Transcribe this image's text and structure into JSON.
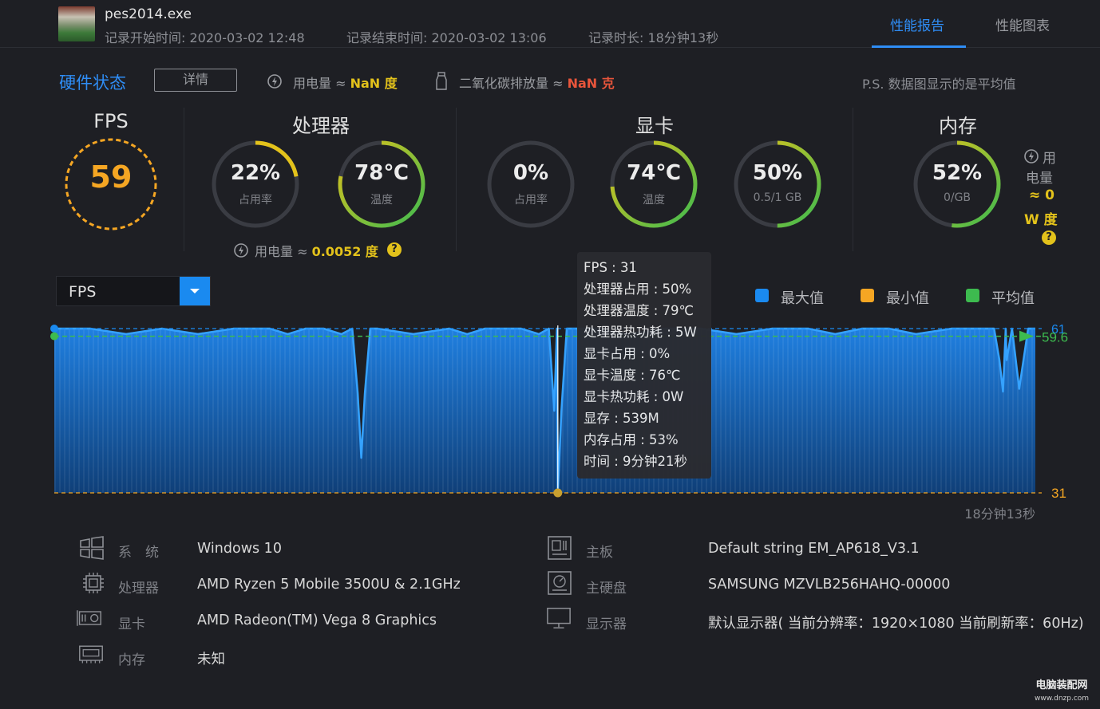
{
  "header": {
    "app_name": "pes2014.exe",
    "start_time": "记录开始时间: 2020-03-02 12:48",
    "end_time": "记录结束时间: 2020-03-02 13:06",
    "duration": "记录时长: 18分钟13秒",
    "tabs": [
      {
        "label": "性能报告",
        "active": true
      },
      {
        "label": "性能图表",
        "active": false
      }
    ]
  },
  "status": {
    "title": "硬件状态",
    "detail_button": "详情",
    "power_label": "用电量 ≈",
    "power_value": "NaN 度",
    "co2_label": "二氧化碳排放量 ≈",
    "co2_value": "NaN 克",
    "ps_note": "P.S. 数据图显示的是平均值"
  },
  "fps": {
    "title": "FPS",
    "value": "59"
  },
  "cpu": {
    "title": "处理器",
    "usage": {
      "value": "22%",
      "label": "占用率",
      "level": 0.22
    },
    "temp": {
      "value": "78℃",
      "label": "温度",
      "level": 0.78
    },
    "power_label": "用电量 ≈",
    "power_value": "0.0052 度",
    "help": "?"
  },
  "gpu": {
    "title": "显卡",
    "usage": {
      "value": "0%",
      "label": "占用率",
      "level": 0.0
    },
    "temp": {
      "value": "74℃",
      "label": "温度",
      "level": 0.74
    },
    "vram": {
      "value": "50%",
      "label": "0.5/1 GB",
      "level": 0.5
    }
  },
  "memory": {
    "title": "内存",
    "usage": {
      "value": "52%",
      "label": "0/GB",
      "level": 0.52
    },
    "power_lines": [
      "用",
      "电量",
      "≈ 0",
      "W 度"
    ],
    "help": "?"
  },
  "colors": {
    "accent": "#2f8df5",
    "fps": "#f5a623",
    "max": "#1a8af0",
    "min": "#f5a623",
    "avg": "#3dbb4f",
    "yellow": "#e3c21b",
    "red": "#e8553b"
  },
  "chart_controls": {
    "metric_select": "FPS",
    "legend": [
      {
        "label": "最大值",
        "color": "#1a8af0"
      },
      {
        "label": "最小值",
        "color": "#f5a623"
      },
      {
        "label": "平均值",
        "color": "#3dbb4f"
      }
    ]
  },
  "chart_data": {
    "type": "area",
    "series_name": "FPS",
    "x_label_end": "18分钟13秒",
    "max_value": 61,
    "min_value": 31,
    "avg_value": 59.6,
    "ylim": [
      31,
      61
    ],
    "duration_seconds": 1093,
    "x": [
      0,
      40,
      80,
      120,
      160,
      200,
      240,
      260,
      280,
      300,
      320,
      360,
      400,
      440,
      460,
      480,
      520,
      540,
      560,
      600,
      640,
      680,
      720,
      760,
      800,
      840,
      870,
      900,
      930,
      960,
      1000,
      1040,
      1060,
      1075,
      1085,
      1093
    ],
    "y": [
      61,
      61,
      60,
      61,
      60,
      61,
      61,
      60,
      61,
      61,
      60,
      61,
      60,
      61,
      60,
      61,
      61,
      60,
      61,
      61,
      60,
      61,
      61,
      60,
      61,
      61,
      60,
      61,
      61,
      60,
      61,
      61,
      61,
      50,
      61,
      61
    ],
    "dips": [
      {
        "x": 342,
        "y": 37.4
      },
      {
        "x": 561,
        "y": 31
      },
      {
        "x": 1057,
        "y": 49.5
      }
    ],
    "min_point": {
      "x": 561,
      "y": 31
    }
  },
  "tooltip": {
    "lines": [
      "FPS : 31",
      "处理器占用 : 50%",
      "处理器温度 : 79℃",
      "处理器热功耗 : 5W",
      "显卡占用 : 0%",
      "显卡温度 : 76℃",
      "显卡热功耗 : 0W",
      "显存 : 539M",
      "内存占用 : 53%",
      "时间 : 9分钟21秒"
    ]
  },
  "system_info": [
    {
      "label": "系　统",
      "value": "Windows 10",
      "icon": "windows-icon"
    },
    {
      "label": "处理器",
      "value": "AMD Ryzen 5 Mobile 3500U & 2.1GHz",
      "icon": "cpu-icon"
    },
    {
      "label": "显卡",
      "value": "AMD Radeon(TM) Vega 8 Graphics",
      "icon": "gpu-icon"
    },
    {
      "label": "内存",
      "value": "未知",
      "icon": "memory-icon"
    },
    {
      "label": "主板",
      "value": "Default string EM_AP618_V3.1",
      "icon": "motherboard-icon"
    },
    {
      "label": "主硬盘",
      "value": "SAMSUNG MZVLB256HAHQ-00000",
      "icon": "harddisk-icon"
    },
    {
      "label": "显示器",
      "value": "默认显示器( 当前分辨率：1920×1080 当前刷新率：60Hz)",
      "icon": "monitor-icon"
    }
  ],
  "watermark": {
    "title": "电脑装配网",
    "url": "www.dnzp.com"
  }
}
